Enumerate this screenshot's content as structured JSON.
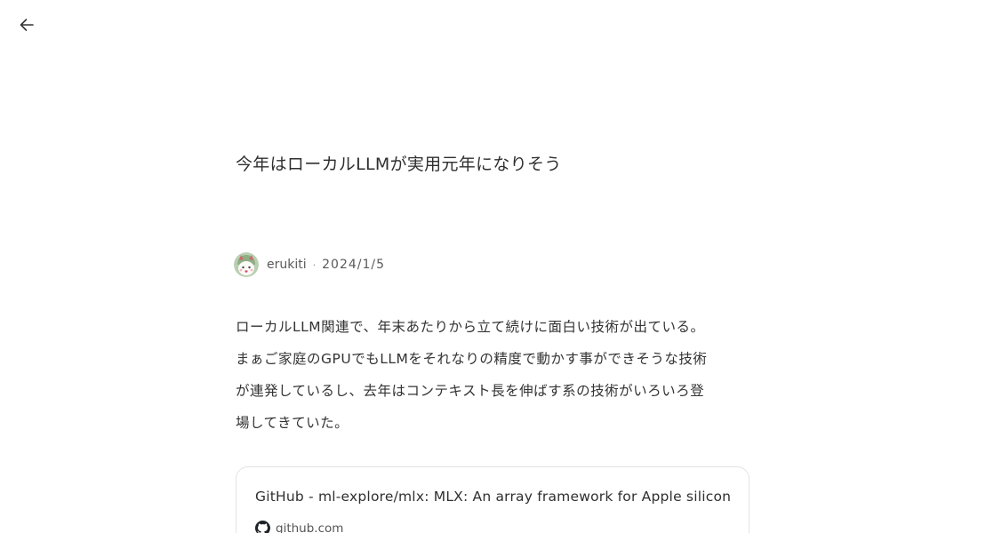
{
  "nav": {
    "back_icon": "arrow-left-icon"
  },
  "article": {
    "title": "今年はローカルLLMが実用元年になりそう",
    "author": "erukiti",
    "separator": "·",
    "date": "2024/1/5",
    "paragraph_lines": [
      "ローカルLLM関連で、年末あたりから立て続けに面白い技術が出ている。",
      "まぁご家庭のGPUでもLLMをそれなりの精度で動かす事ができそうな技術",
      "が連発しているし、去年はコンテキスト長を伸ばす系の技術がいろいろ登",
      "場してきていた。"
    ]
  },
  "link_card": {
    "title": "GitHub - ml-explore/mlx: MLX: An array framework for Apple silicon",
    "domain": "github.com",
    "icon": "github-icon"
  }
}
